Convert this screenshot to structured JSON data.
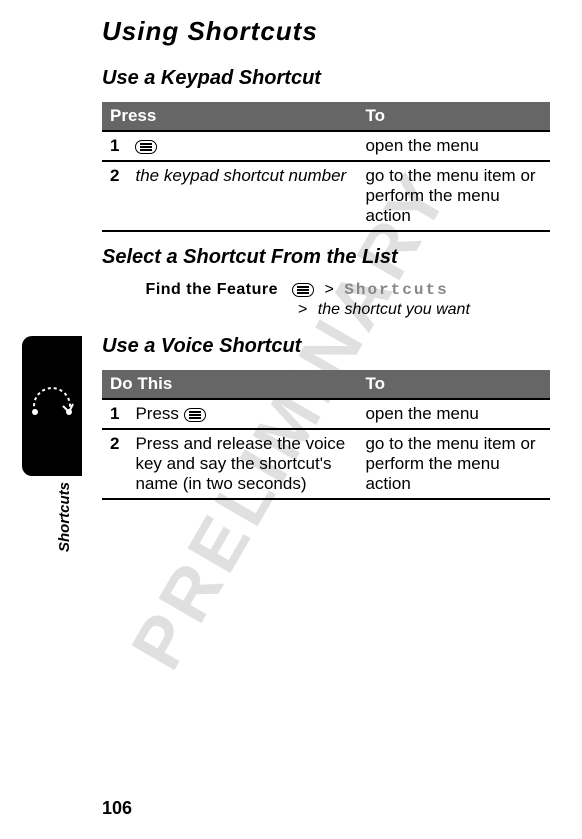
{
  "watermark": "PRELIMINARY",
  "section_label": "Shortcuts",
  "heading_main": "Using Shortcuts",
  "heading_keypad": "Use a Keypad Shortcut",
  "table1": {
    "header_press": "Press",
    "header_to": "To",
    "row1_step": "1",
    "row1_to": "open the menu",
    "row2_step": "2",
    "row2_press": "the keypad shortcut number",
    "row2_to": "go to the menu item or perform the menu action"
  },
  "heading_select": "Select a Shortcut From the List",
  "find_feature_label": "Find the Feature",
  "feature_path": {
    "gt1": ">",
    "shortcuts_text": "Shortcuts",
    "gt2": ">",
    "line2": "the shortcut you want"
  },
  "heading_voice": "Use a Voice Shortcut",
  "table2": {
    "header_do": "Do This",
    "header_to": "To",
    "row1_step": "1",
    "row1_do_prefix": "Press ",
    "row1_to": "open the menu",
    "row2_step": "2",
    "row2_do": "Press and release the voice key and say the shortcut's name (in two seconds)",
    "row2_to": "go to the menu item or perform the menu action"
  },
  "page_number": "106"
}
